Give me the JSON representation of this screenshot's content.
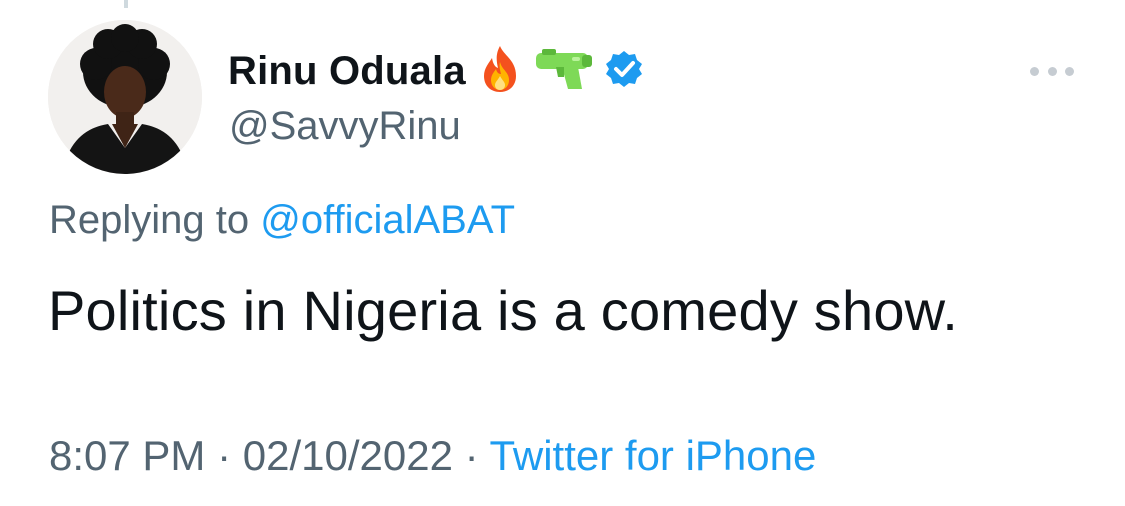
{
  "tweet": {
    "author": {
      "display_name": "Rinu Oduala",
      "handle": "@SavvyRinu",
      "badges": [
        "fire-emoji",
        "water-pistol-emoji",
        "verified-badge-icon"
      ]
    },
    "reply_prefix": "Replying to ",
    "reply_to": "@officialABAT",
    "text": "Politics in Nigeria is a comedy show.",
    "time": "8:07 PM",
    "separator": " · ",
    "date": "02/10/2022",
    "source": "Twitter for iPhone"
  },
  "colors": {
    "link": "#1d9bf0",
    "secondary_text": "#536471",
    "primary_text": "#0f1419",
    "verified": "#1d9bf0"
  }
}
